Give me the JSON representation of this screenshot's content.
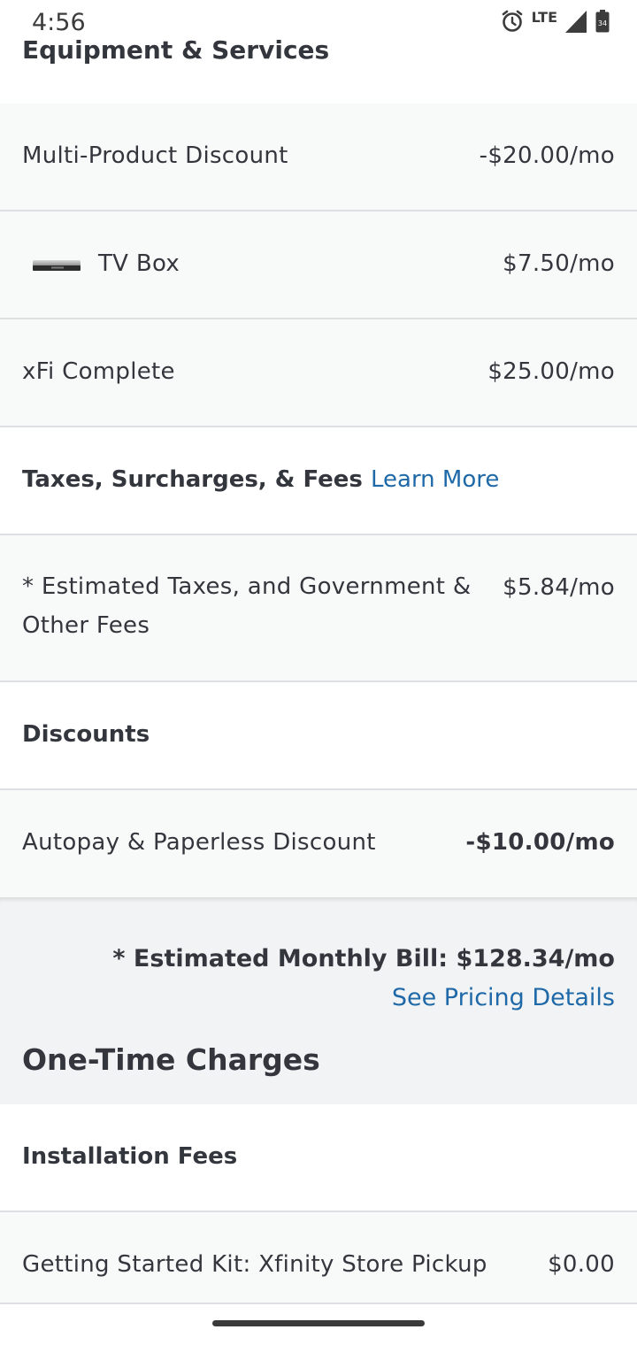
{
  "status_bar": {
    "time": "4:56",
    "network": "LTE",
    "battery_level": "34"
  },
  "equipment_section": {
    "title": "Equipment & Services"
  },
  "rows": {
    "multi_product": {
      "label": "Multi-Product Discount",
      "value": "-$20.00/mo"
    },
    "tv_box": {
      "label": "TV Box",
      "value": "$7.50/mo"
    },
    "xfi": {
      "label": "xFi Complete",
      "value": "$25.00/mo"
    },
    "taxes_heading": {
      "label": "Taxes, Surcharges, & Fees",
      "link": "Learn More"
    },
    "estimated_taxes": {
      "label_line1": "* Estimated Taxes, and Government &",
      "label_line2": "Other Fees",
      "value": "$5.84/mo"
    },
    "discounts_heading": {
      "label": "Discounts"
    },
    "autopay": {
      "label": "Autopay & Paperless Discount",
      "value": "-$10.00/mo"
    },
    "installation_heading": {
      "label": "Installation Fees"
    },
    "starter_kit": {
      "label": "Getting Started Kit: Xfinity Store Pickup",
      "value": "$0.00"
    }
  },
  "summary": {
    "estimated_bill": "* Estimated Monthly Bill: $128.34/mo",
    "see_pricing": "See Pricing Details",
    "one_time_title": "One-Time Charges"
  },
  "colors": {
    "link": "#1f69a8",
    "discount_green": "#2e9b5e",
    "text": "#33373d",
    "alt_row": "#f8f9f9",
    "summary_bg": "#f2f3f5"
  }
}
